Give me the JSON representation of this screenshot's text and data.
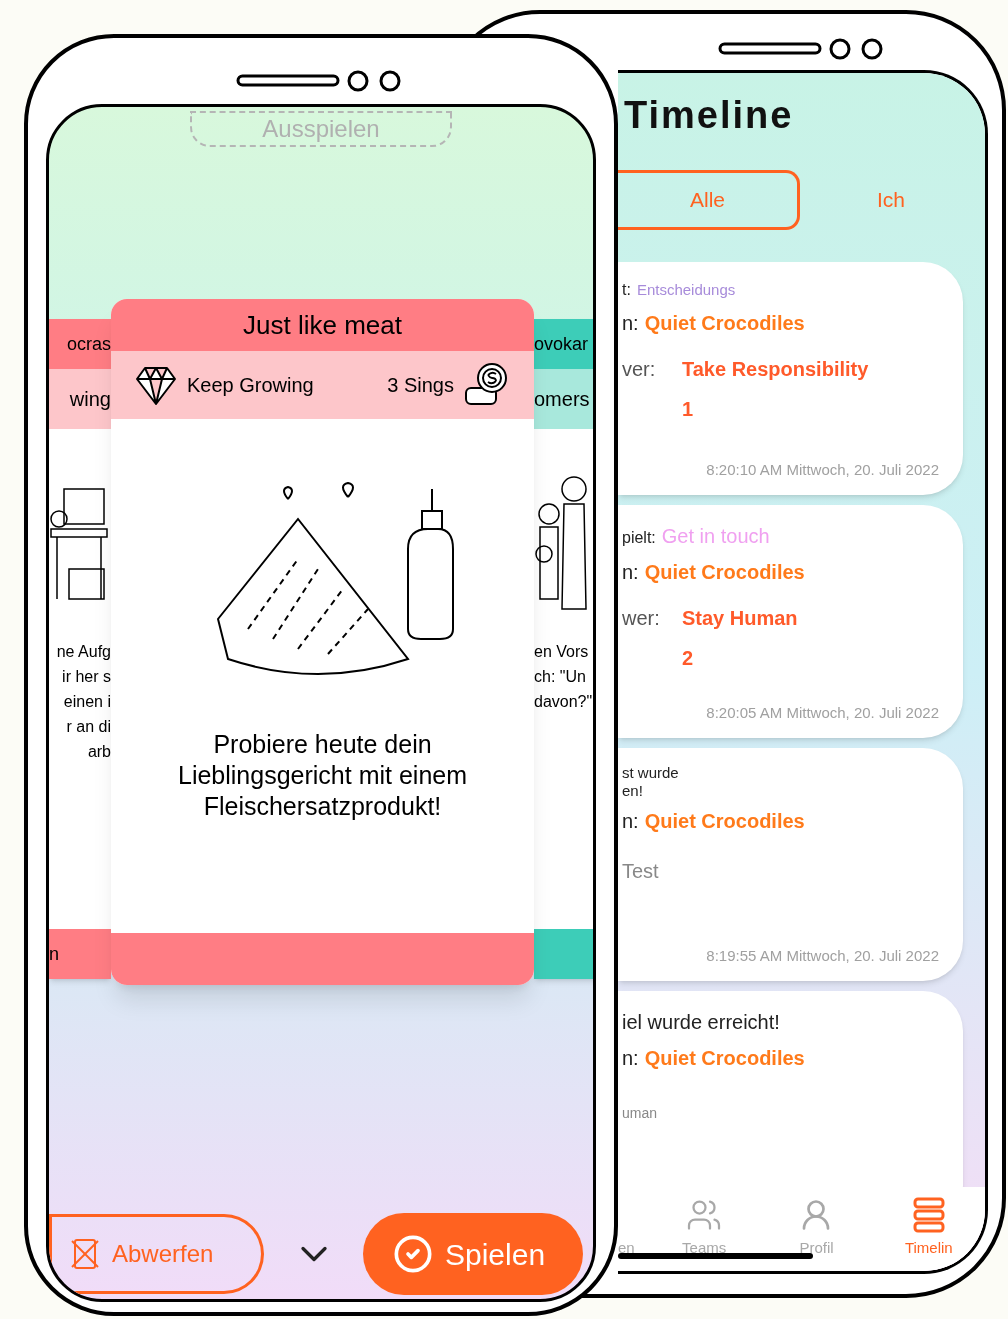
{
  "play_screen": {
    "header_button": "Ausspielen",
    "left_card": {
      "title": "ocras",
      "subtitle": "wing",
      "text_lines": [
        "ne Aufg",
        "ir her s",
        "einen i",
        "r an di",
        "arb"
      ],
      "footer": "n"
    },
    "main_card": {
      "title": "Just like meat",
      "category": "Keep Growing",
      "reward": "3 Sings",
      "text": "Probiere heute dein Lieblingsgericht mit einem Fleischersatzprodukt!"
    },
    "right_card": {
      "title": "ovokar",
      "subtitle": "omers",
      "text_lines": [
        "en Vors",
        "ch: \"Un",
        "davon?\""
      ]
    },
    "actions": {
      "discard": "Abwerfen",
      "play": "Spielen"
    }
  },
  "timeline_screen": {
    "title": "Timeline",
    "tabs": [
      {
        "label": "Alle",
        "selected": true
      },
      {
        "label": "Ich",
        "selected": false
      }
    ],
    "entries": [
      {
        "heading": {
          "label": "t:",
          "value": "Entscheidungs",
          "color": "#a78bda"
        },
        "team": {
          "label": "n:",
          "value": "Quiet Crocodiles"
        },
        "answer": {
          "label": "ver:",
          "values": [
            "Take Responsibility",
            "1"
          ]
        },
        "timestamp": "8:20:10 AM Mittwoch, 20. Juli 2022"
      },
      {
        "heading": {
          "label": "pielt:",
          "value": "Get in touch",
          "color": "#f0a0f0"
        },
        "team": {
          "label": "n:",
          "value": "Quiet Crocodiles"
        },
        "answer": {
          "label": "wer:",
          "values": [
            "Stay Human",
            "2"
          ]
        },
        "timestamp": "8:20:05 AM Mittwoch, 20. Juli 2022"
      },
      {
        "message": [
          "st wurde",
          "en!"
        ],
        "team": {
          "label": "n:",
          "value": "Quiet Crocodiles"
        },
        "note": "Test",
        "timestamp": "8:19:55 AM Mittwoch, 20. Juli 2022"
      },
      {
        "message": [
          "iel wurde erreicht!"
        ],
        "team": {
          "label": "n:",
          "value": "Quiet Crocodiles"
        },
        "small_note": "uman"
      }
    ],
    "nav": [
      {
        "label": "en",
        "kind": "cards",
        "selected": false
      },
      {
        "label": "Teams",
        "kind": "teams",
        "selected": false
      },
      {
        "label": "Profil",
        "kind": "profile",
        "selected": false
      },
      {
        "label": "Timelin",
        "kind": "timeline",
        "selected": true
      }
    ]
  }
}
